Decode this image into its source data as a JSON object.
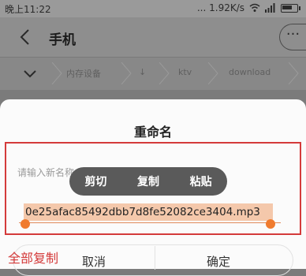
{
  "status_bar": {
    "time": "晚上11:22",
    "speed": "... 1.92K/s"
  },
  "titlebar": {
    "title": "手机",
    "more": "···"
  },
  "breadcrumb": {
    "items": [
      "内存设备",
      "↓",
      "ktv",
      "download"
    ]
  },
  "dialog": {
    "title": "重命名",
    "label": "请输入新名称",
    "context_menu": [
      "剪切",
      "复制",
      "粘贴"
    ],
    "filename": "0e25afac85492dbb7d8fe52082ce3404.mp3",
    "cancel": "取消",
    "confirm": "确定"
  },
  "annotation": {
    "text": "全部复制",
    "color": "#d43a3a"
  },
  "colors": {
    "selection": "#f4c8ab",
    "handle": "#f07b2e",
    "menu": "#5a5a5a"
  }
}
